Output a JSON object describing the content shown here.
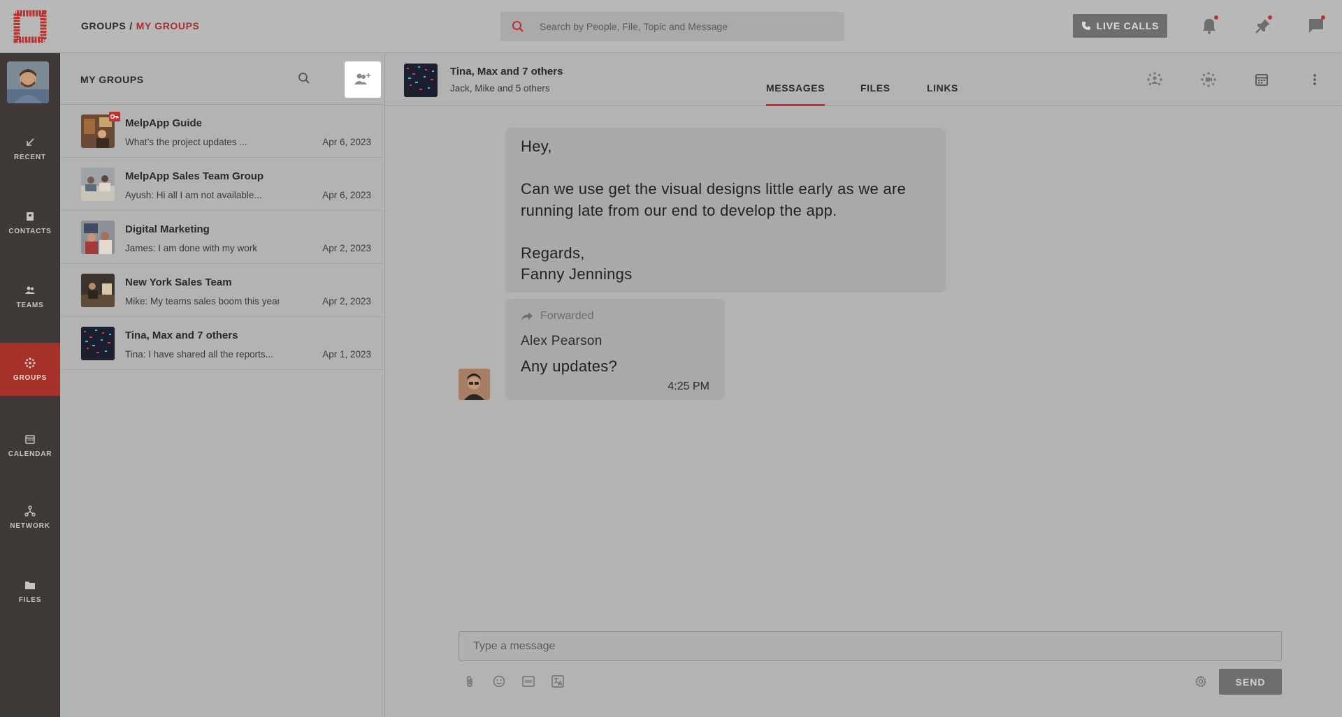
{
  "breadcrumb": {
    "parent": "GROUPS",
    "separator": "/",
    "current": "MY GROUPS"
  },
  "search": {
    "placeholder": "Search by People, File, Topic and Message"
  },
  "topbar": {
    "live_calls_label": "LIVE CALLS",
    "icons": [
      "bell-icon",
      "pin-icon",
      "chat-icon"
    ],
    "notification_dots": [
      "bell-icon",
      "pin-icon",
      "chat-icon"
    ]
  },
  "rail": {
    "items": [
      {
        "id": "recent",
        "label": "RECENT",
        "icon": "arrow-down-left-icon"
      },
      {
        "id": "contacts",
        "label": "CONTACTS",
        "icon": "contact-book-icon"
      },
      {
        "id": "teams",
        "label": "TEAMS",
        "icon": "people-icon"
      },
      {
        "id": "groups",
        "label": "GROUPS",
        "icon": "groups-dots-icon",
        "active": true
      },
      {
        "id": "calendar",
        "label": "CALENDAR",
        "icon": "calendar-icon"
      },
      {
        "id": "network",
        "label": "NETWORK",
        "icon": "network-icon"
      },
      {
        "id": "files",
        "label": "FILES",
        "icon": "folder-icon"
      }
    ]
  },
  "groups_panel": {
    "title": "MY GROUPS",
    "items": [
      {
        "name": "MelpApp Guide",
        "last_message": "What’s the project updates ...",
        "date": "Apr 6, 2023",
        "badge": true
      },
      {
        "name": "MelpApp Sales Team Group",
        "last_message": "Ayush: Hi all I am not available...",
        "date": "Apr 6, 2023"
      },
      {
        "name": "Digital Marketing",
        "last_message": "James: I am done with my work",
        "date": "Apr 2, 2023"
      },
      {
        "name": "New York Sales Team",
        "last_message": "Mike: My teams sales boom this year.",
        "date": "Apr 2, 2023"
      },
      {
        "name": "Tina, Max and 7 others",
        "last_message": "Tina: I have shared all the reports...",
        "date": "Apr 1, 2023"
      }
    ]
  },
  "chat": {
    "title": "Tina, Max and 7 others",
    "subtitle": "Jack, Mike and 5 others",
    "tabs": [
      {
        "label": "MESSAGES",
        "active": true
      },
      {
        "label": "FILES"
      },
      {
        "label": "LINKS"
      }
    ],
    "messages": {
      "m1": {
        "greeting": "Hey,",
        "body": "Can we use get the visual designs little early as we are running late from our end to develop the app.",
        "closing": "Regards,",
        "signature": "Fanny Jennings"
      },
      "m2": {
        "forwarded_label": "Forwarded",
        "author": "Alex Pearson",
        "text": "Any updates?",
        "time": "4:25 PM"
      }
    },
    "composer": {
      "placeholder": "Type a message",
      "send_label": "SEND"
    }
  },
  "colors": {
    "accent": "#c4302b",
    "rail_bg": "#3f3a38",
    "active_rail": "#a8302b",
    "bubble": "#a9a9a9"
  }
}
